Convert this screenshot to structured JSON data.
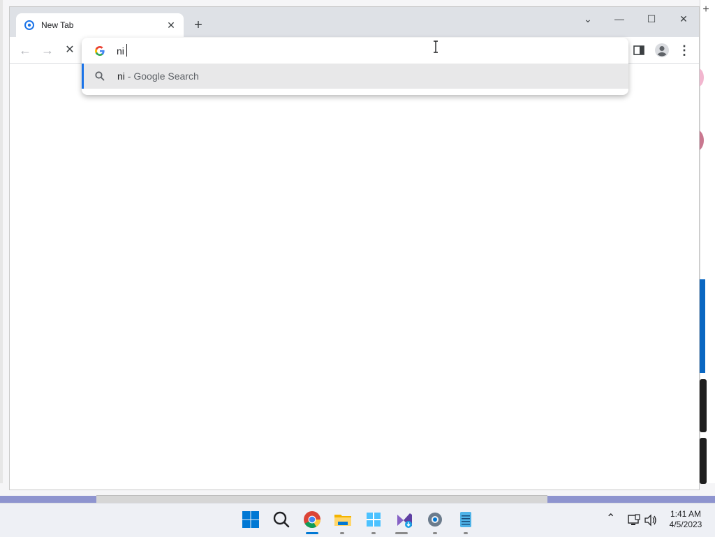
{
  "browser": {
    "tab": {
      "title": "New Tab",
      "close_glyph": "✕"
    },
    "new_tab_glyph": "+",
    "window_controls": {
      "dropdown_glyph": "⌄",
      "minimize_glyph": "—",
      "maximize_glyph": "☐",
      "close_glyph": "✕"
    },
    "nav": {
      "back_glyph": "←",
      "forward_glyph": "→",
      "stop_glyph": "✕"
    },
    "omnibox": {
      "value": "ni",
      "suggestion": {
        "query": "ni",
        "separator": " - ",
        "source": "Google Search"
      }
    },
    "toolbar_right": {
      "side_panel_icon": "side-panel-icon",
      "profile_icon": "profile-icon",
      "menu_glyph": "⋮"
    }
  },
  "desktop": {
    "edge_glyph": "+"
  },
  "taskbar": {
    "apps": [
      "start",
      "search",
      "chrome",
      "file-explorer",
      "windows-app",
      "visual-studio-installer",
      "settings",
      "notepad"
    ],
    "tray": {
      "chevron_glyph": "⌃"
    },
    "clock": {
      "time": "1:41 AM",
      "date": "4/5/2023"
    }
  },
  "colors": {
    "accent": "#1a73e8",
    "tabstrip": "#dee1e6",
    "taskbar": "#eef0f5"
  }
}
